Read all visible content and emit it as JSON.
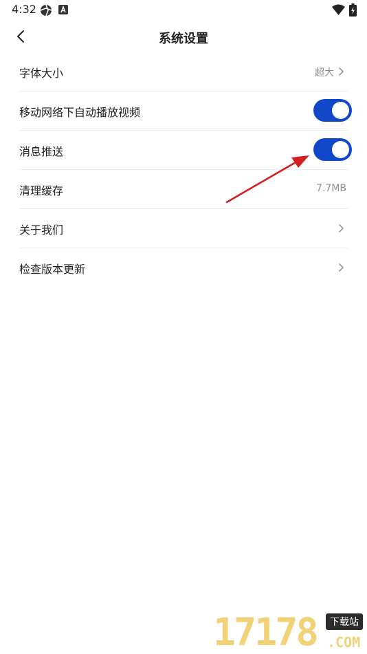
{
  "status_bar": {
    "time": "4:32",
    "icons": [
      "aperture-icon",
      "a-app-icon",
      "wifi-icon",
      "battery-charging-icon"
    ]
  },
  "header": {
    "title": "系统设置",
    "back_icon": "chevron-left-icon"
  },
  "settings": {
    "items": [
      {
        "label": "字体大小",
        "value": "超大",
        "control": "chevron"
      },
      {
        "label": "移动网络下自动播放视频",
        "control": "toggle",
        "on": true
      },
      {
        "label": "消息推送",
        "control": "toggle",
        "on": true
      },
      {
        "label": "清理缓存",
        "value": "7.7MB",
        "control": "value"
      },
      {
        "label": "关于我们",
        "control": "chevron"
      },
      {
        "label": "检查版本更新",
        "control": "chevron"
      }
    ]
  },
  "colors": {
    "toggle_on": "#1148c9",
    "annotation_arrow": "#d41f1f",
    "watermark": "#f1d279"
  },
  "watermark": {
    "digits": "17178",
    "tag": "下载站",
    "suffix": ".COM"
  }
}
